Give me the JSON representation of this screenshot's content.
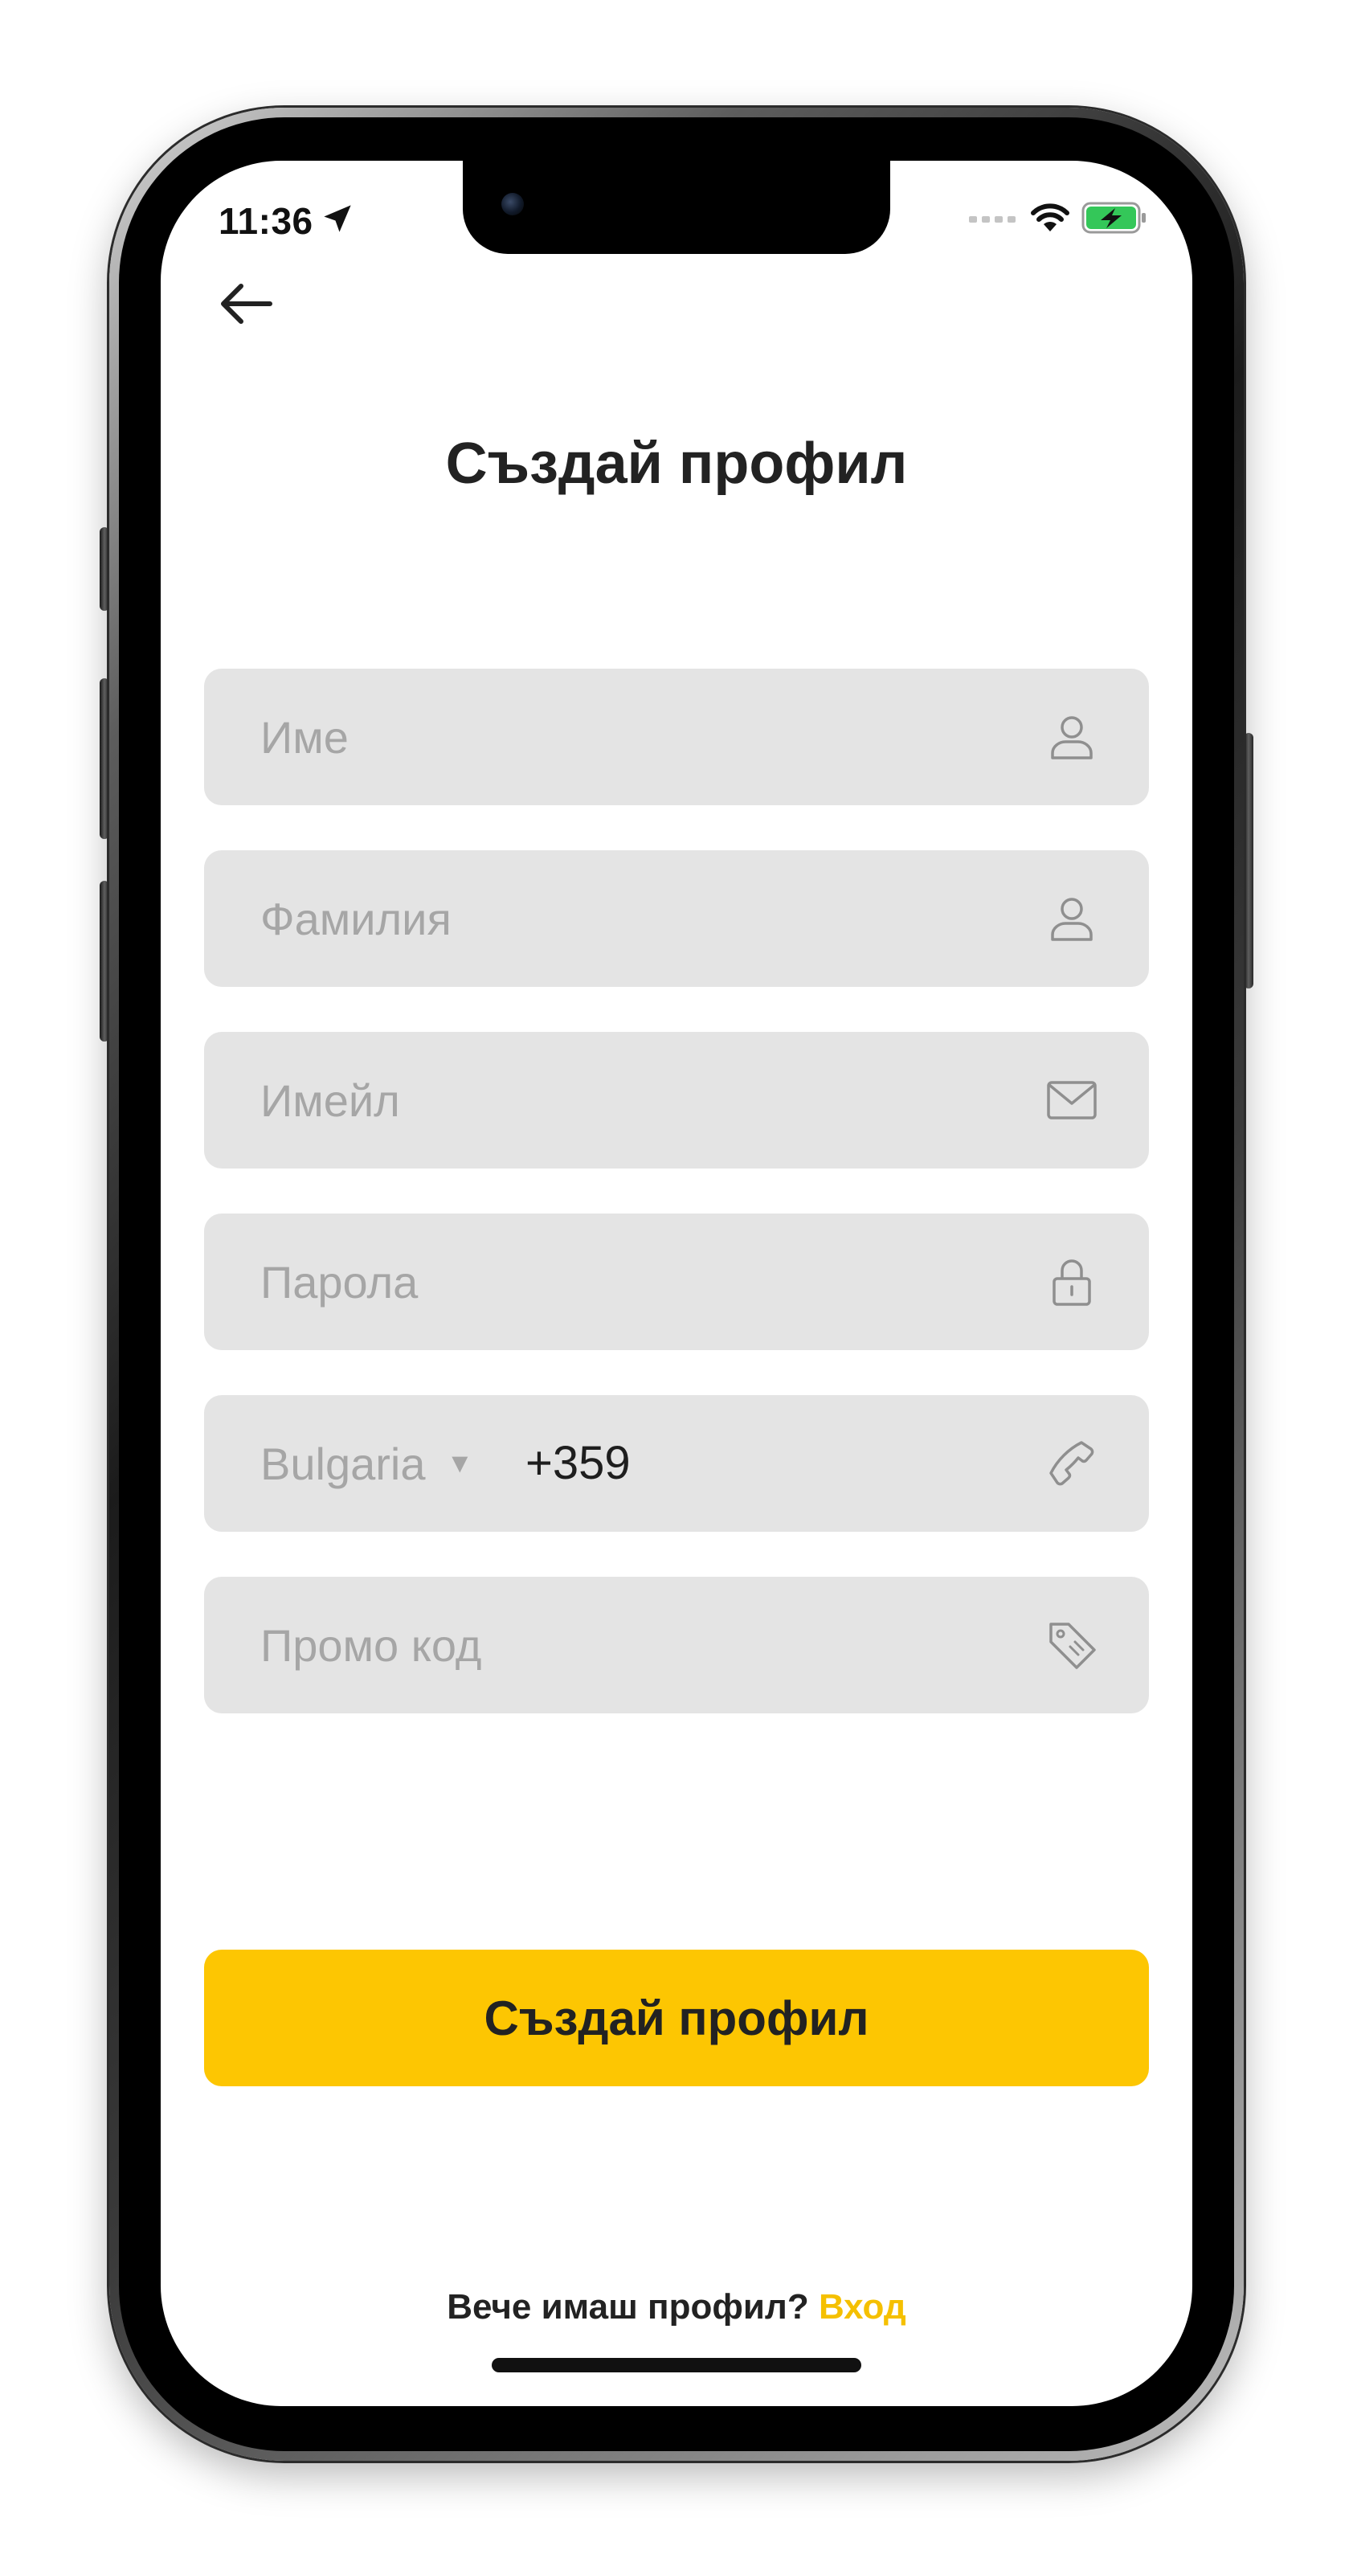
{
  "status_bar": {
    "time": "11:36",
    "location_icon": "location-arrow-icon",
    "signal_icon": "cellular-signal-icon",
    "wifi_icon": "wifi-icon",
    "battery_icon": "battery-charging-icon"
  },
  "header": {
    "back_icon": "arrow-left-icon",
    "title": "Създай профил"
  },
  "form": {
    "first_name": {
      "placeholder": "Име",
      "icon": "user-icon"
    },
    "last_name": {
      "placeholder": "Фамилия",
      "icon": "user-icon"
    },
    "email": {
      "placeholder": "Имейл",
      "icon": "envelope-icon"
    },
    "password": {
      "placeholder": "Парола",
      "icon": "lock-icon"
    },
    "phone": {
      "country": "Bulgaria",
      "dropdown_glyph": "▼",
      "dial_code": "+359",
      "icon": "phone-icon"
    },
    "promo_code": {
      "placeholder": "Промо код",
      "icon": "tag-icon"
    }
  },
  "submit": {
    "label": "Създай профил"
  },
  "footer": {
    "question": "Вече имаш профил?",
    "login_link": "Вход"
  },
  "colors": {
    "accent": "#fdc602",
    "link": "#f5c000",
    "field_bg": "#e4e4e4",
    "placeholder": "#a6a6a6",
    "text": "#222222",
    "battery": "#34c759"
  }
}
